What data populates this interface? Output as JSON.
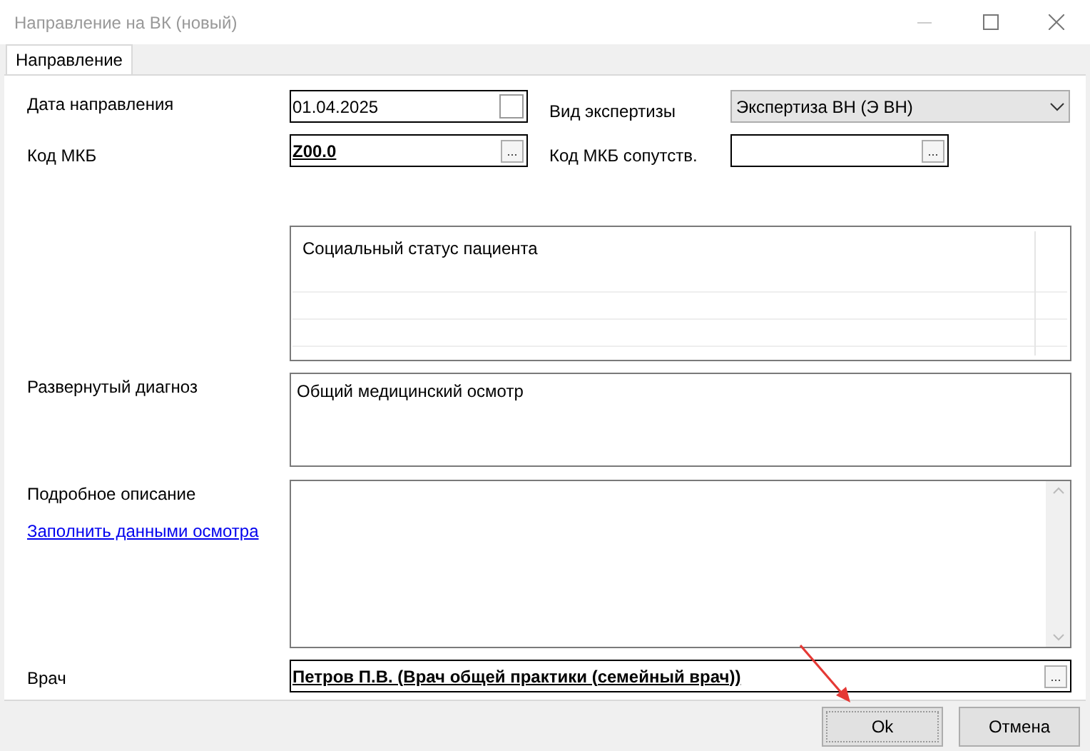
{
  "window": {
    "title": "Направление на ВК (новый)"
  },
  "tabs": [
    {
      "label": "Направление",
      "selected": true
    }
  ],
  "form": {
    "referral_date": {
      "label": "Дата направления",
      "value": "01.04.2025"
    },
    "expertise_type": {
      "label": "Вид экспертизы",
      "value": "Экспертиза ВН (Э ВН)"
    },
    "icd_code": {
      "label": "Код МКБ",
      "value": "Z00.0",
      "button": "..."
    },
    "icd_secondary": {
      "label": "Код МКБ сопутств.",
      "button": "..."
    },
    "social_status": {
      "items": [
        "Социальный статус пациента"
      ]
    },
    "diagnosis": {
      "label": "Развернутый диагноз",
      "value": "Общий медицинский осмотр"
    },
    "description": {
      "label": "Подробное описание",
      "link": "Заполнить данными осмотра"
    },
    "doctor": {
      "label": "Врач",
      "value": "Петров П.В. (Врач общей практики (семейный врач))",
      "button": "..."
    }
  },
  "buttons": [
    {
      "label": "Ok",
      "selected": true
    },
    {
      "label": "Отмена",
      "selected": false
    }
  ]
}
